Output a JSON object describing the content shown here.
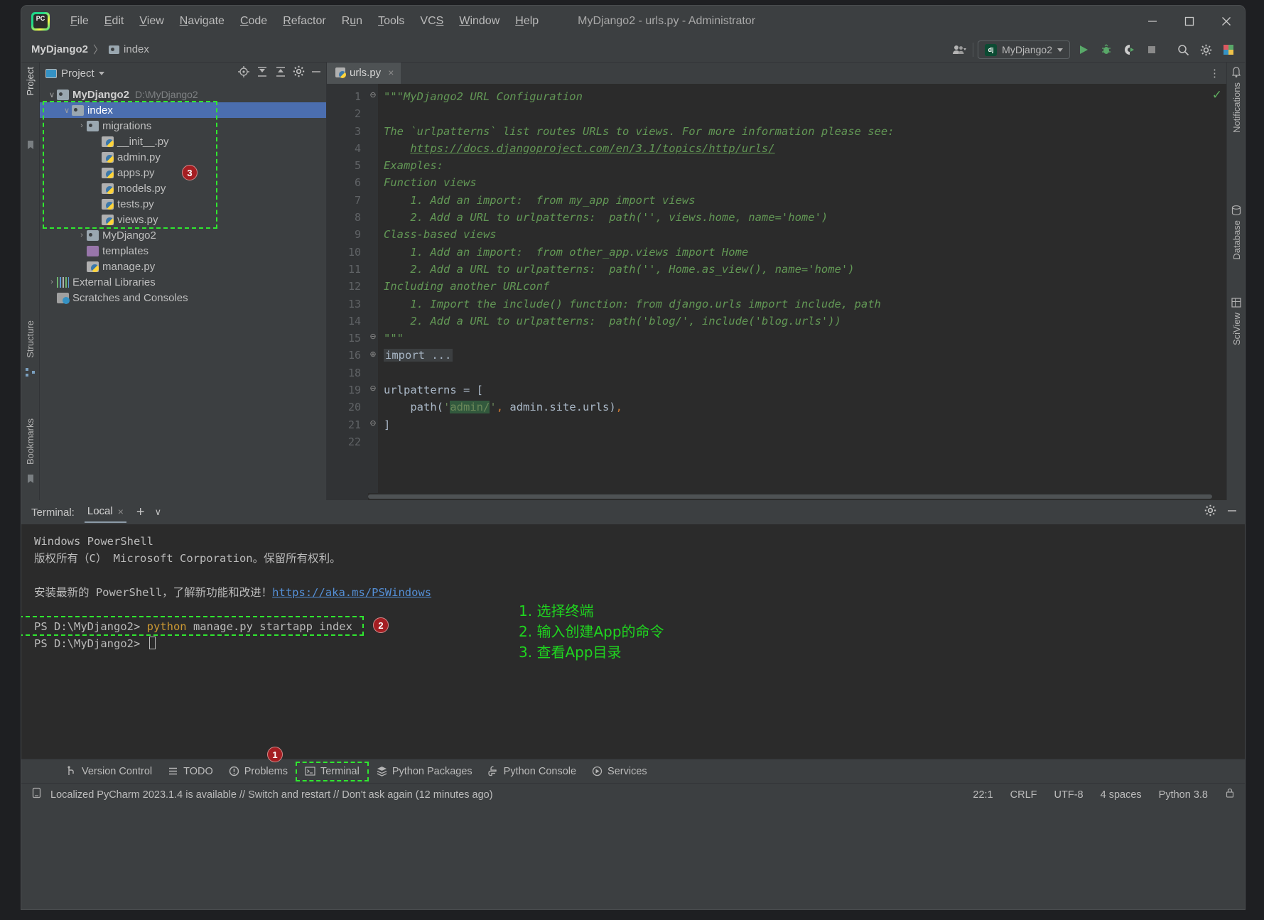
{
  "window": {
    "title": "MyDjango2 - urls.py - Administrator",
    "controls": {
      "minimize": "minimize-icon",
      "maximize": "maximize-icon",
      "close": "close-icon"
    }
  },
  "menubar": {
    "items": [
      {
        "label": "File",
        "mnemonic": "F"
      },
      {
        "label": "Edit",
        "mnemonic": "E"
      },
      {
        "label": "View",
        "mnemonic": "V"
      },
      {
        "label": "Navigate",
        "mnemonic": "N"
      },
      {
        "label": "Code",
        "mnemonic": "C"
      },
      {
        "label": "Refactor",
        "mnemonic": "R"
      },
      {
        "label": "Run",
        "mnemonic": "u"
      },
      {
        "label": "Tools",
        "mnemonic": "T"
      },
      {
        "label": "VCS",
        "mnemonic": "S"
      },
      {
        "label": "Window",
        "mnemonic": "W"
      },
      {
        "label": "Help",
        "mnemonic": "H"
      }
    ]
  },
  "navbar": {
    "crumb_project": "MyDjango2",
    "crumb_folder": "index",
    "separator": "〉",
    "run_config": "MyDjango2",
    "run_config_badge": "dj",
    "icons": [
      "user-group-icon",
      "run-icon",
      "debug-icon",
      "coverage-icon",
      "stop-icon",
      "search-icon",
      "settings-icon",
      "plugin-icon"
    ]
  },
  "left_strip": {
    "top_label": "Project",
    "bottom_labels": [
      "Structure",
      "Bookmarks"
    ]
  },
  "right_strip": {
    "labels": [
      "Notifications",
      "Database",
      "SciView"
    ]
  },
  "project_panel": {
    "title": "Project",
    "header_icons": [
      "locate-icon",
      "expand-all-icon",
      "collapse-all-icon",
      "gear-icon",
      "hide-icon"
    ],
    "tree": [
      {
        "depth": 0,
        "twisty": "∨",
        "icon": "folder-icon",
        "label": "MyDjango2",
        "path": "D:\\MyDjango2",
        "bold": true,
        "selected": false
      },
      {
        "depth": 1,
        "twisty": "∨",
        "icon": "module-folder-icon",
        "label": "index",
        "path": "",
        "bold": false,
        "selected": true
      },
      {
        "depth": 2,
        "twisty": "›",
        "icon": "module-folder-icon",
        "label": "migrations",
        "path": "",
        "bold": false,
        "selected": false
      },
      {
        "depth": 3,
        "twisty": "",
        "icon": "python-file-icon",
        "label": "__init__.py",
        "path": "",
        "bold": false,
        "selected": false
      },
      {
        "depth": 3,
        "twisty": "",
        "icon": "python-file-icon",
        "label": "admin.py",
        "path": "",
        "bold": false,
        "selected": false
      },
      {
        "depth": 3,
        "twisty": "",
        "icon": "python-file-icon",
        "label": "apps.py",
        "path": "",
        "bold": false,
        "selected": false
      },
      {
        "depth": 3,
        "twisty": "",
        "icon": "python-file-icon",
        "label": "models.py",
        "path": "",
        "bold": false,
        "selected": false
      },
      {
        "depth": 3,
        "twisty": "",
        "icon": "python-file-icon",
        "label": "tests.py",
        "path": "",
        "bold": false,
        "selected": false
      },
      {
        "depth": 3,
        "twisty": "",
        "icon": "python-file-icon",
        "label": "views.py",
        "path": "",
        "bold": false,
        "selected": false
      },
      {
        "depth": 2,
        "twisty": "›",
        "icon": "module-folder-icon",
        "label": "MyDjango2",
        "path": "",
        "bold": false,
        "selected": false
      },
      {
        "depth": 2,
        "twisty": "",
        "icon": "templates-folder-icon",
        "label": "templates",
        "path": "",
        "bold": false,
        "selected": false
      },
      {
        "depth": 2,
        "twisty": "",
        "icon": "python-file-icon",
        "label": "manage.py",
        "path": "",
        "bold": false,
        "selected": false
      },
      {
        "depth": 0,
        "twisty": "›",
        "icon": "external-libraries-icon",
        "label": "External Libraries",
        "path": "",
        "bold": false,
        "selected": false
      },
      {
        "depth": 0,
        "twisty": "",
        "icon": "scratches-icon",
        "label": "Scratches and Consoles",
        "path": "",
        "bold": false,
        "selected": false
      }
    ]
  },
  "editor": {
    "tab_label": "urls.py",
    "tab_close": "×",
    "inspection_ok": "✓",
    "lines": [
      {
        "num": "1",
        "html": "<span class=\"doc\">\"\"\"MyDjango2 URL Configuration</span>",
        "fold": "⊖"
      },
      {
        "num": "2",
        "html": ""
      },
      {
        "num": "3",
        "html": "<span class=\"doc\">The `urlpatterns` list routes URLs to views. For more information please see:</span>"
      },
      {
        "num": "4",
        "html": "<span class=\"doc\">    </span><span class=\"lnk\">https://docs.djangoproject.com/en/3.1/topics/http/urls/</span>"
      },
      {
        "num": "5",
        "html": "<span class=\"doc\">Examples:</span>"
      },
      {
        "num": "6",
        "html": "<span class=\"doc\">Function views</span>"
      },
      {
        "num": "7",
        "html": "<span class=\"doc\">    1. Add an import:  from my_app import views</span>"
      },
      {
        "num": "8",
        "html": "<span class=\"doc\">    2. Add a URL to urlpatterns:  path('', views.home, name='home')</span>"
      },
      {
        "num": "9",
        "html": "<span class=\"doc\">Class-based views</span>"
      },
      {
        "num": "10",
        "html": "<span class=\"doc\">    1. Add an import:  from other_app.views import Home</span>"
      },
      {
        "num": "11",
        "html": "<span class=\"doc\">    2. Add a URL to urlpatterns:  path('', Home.as_view(), name='home')</span>"
      },
      {
        "num": "12",
        "html": "<span class=\"doc\">Including another URLconf</span>"
      },
      {
        "num": "13",
        "html": "<span class=\"doc\">    1. Import the include() function: from django.urls import include, path</span>"
      },
      {
        "num": "14",
        "html": "<span class=\"doc\">    2. Add a URL to urlpatterns:  path('blog/', include('blog.urls'))</span>"
      },
      {
        "num": "15",
        "html": "<span class=\"doc\">\"\"\"</span>",
        "fold": "⊖"
      },
      {
        "num": "16",
        "html": "<span class=\"fold-import\">import ...</span>",
        "fold": "⊕"
      },
      {
        "num": "18",
        "html": ""
      },
      {
        "num": "19",
        "html": "<span class=\"punct\">urlpatterns = [</span>",
        "fold": "⊖"
      },
      {
        "num": "20",
        "html": "<span class=\"punct\">    path(</span><span class=\"str\">'</span><span class=\"strhl\">admin/</span><span class=\"str\">'</span><span class=\"comma\">,</span><span class=\"punct\"> admin.site.urls)</span><span class=\"comma\">,</span>"
      },
      {
        "num": "21",
        "html": "<span class=\"punct\">]</span>",
        "fold": "⊖"
      },
      {
        "num": "22",
        "html": ""
      }
    ]
  },
  "terminal": {
    "label": "Terminal:",
    "tab": "Local",
    "tab_close": "×",
    "add_button": "+",
    "dropdown_button": "∨",
    "settings_icon": "gear-icon",
    "hide_icon": "hide-icon",
    "lines": [
      {
        "text": "Windows PowerShell",
        "type": "plain"
      },
      {
        "text": "版权所有（C） Microsoft Corporation。保留所有权利。",
        "type": "plain"
      },
      {
        "text": "",
        "type": "plain"
      },
      {
        "text": "安装最新的 PowerShell，了解新功能和改进！",
        "link": "https://aka.ms/PSWindows",
        "type": "link"
      },
      {
        "text": "",
        "type": "plain"
      },
      {
        "prompt": "PS D:\\MyDjango2> ",
        "cmd_kw": "python",
        "cmd_rest": " manage.py startapp index",
        "type": "command"
      },
      {
        "prompt": "PS D:\\MyDjango2> ",
        "type": "cursor"
      }
    ]
  },
  "annotations": {
    "color": "#1fd61f",
    "badge_color": "#a41e22",
    "steps": [
      "1. 选择终端",
      "2. 输入创建App的命令",
      "3. 查看App目录"
    ],
    "badges": [
      "1",
      "2",
      "3"
    ]
  },
  "bottom_tabs": [
    {
      "label": "Version Control",
      "icon": "branch-icon",
      "active": false
    },
    {
      "label": "TODO",
      "icon": "list-icon",
      "active": false
    },
    {
      "label": "Problems",
      "icon": "warning-icon",
      "active": false
    },
    {
      "label": "Terminal",
      "icon": "terminal-icon",
      "active": true
    },
    {
      "label": "Python Packages",
      "icon": "packages-icon",
      "active": false
    },
    {
      "label": "Python Console",
      "icon": "python-console-icon",
      "active": false
    },
    {
      "label": "Services",
      "icon": "services-icon",
      "active": false
    }
  ],
  "statusbar": {
    "icon": "memory-icon",
    "message": "Localized PyCharm 2023.1.4 is available // Switch and restart // Don't ask again (12 minutes ago)",
    "caret": "22:1",
    "line_ending": "CRLF",
    "encoding": "UTF-8",
    "indent": "4 spaces",
    "interpreter": "Python 3.8",
    "lock_icon": "lock-icon"
  }
}
